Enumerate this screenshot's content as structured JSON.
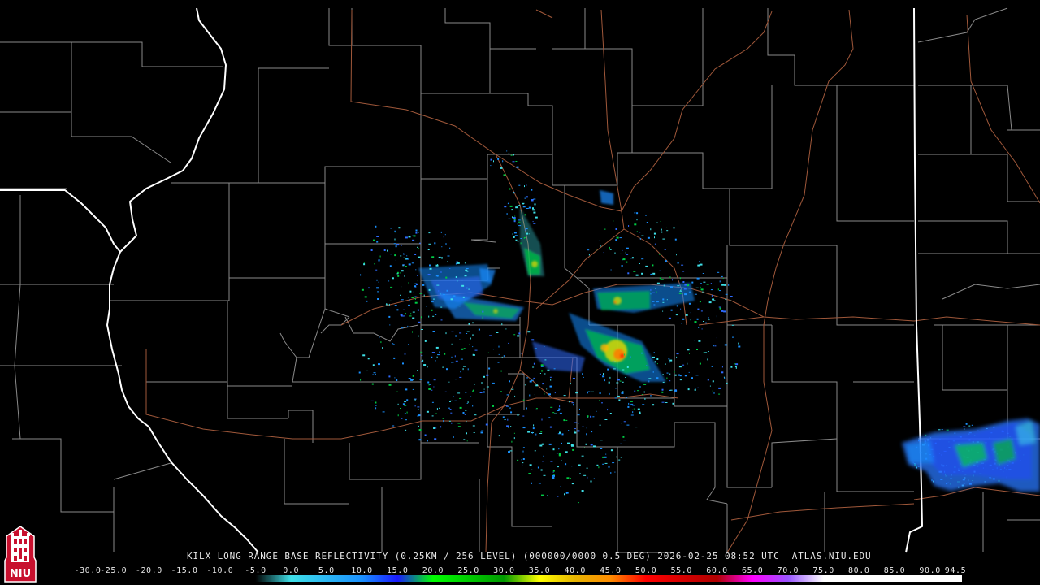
{
  "caption": "KILX LONG RANGE BASE REFLECTIVITY (0.25KM / 256 LEVEL) (000000/0000 0.5 DEG) 2026-02-25 08:52 UTC  ATLAS.NIU.EDU",
  "logo": {
    "text": "NIU",
    "color": "#c8102e"
  },
  "colors": {
    "background": "#000000",
    "county_lines": "#8a8a8a",
    "state_lines": "#ffffff",
    "highways": "#a0583a"
  },
  "scale": {
    "labels": [
      "-30.0",
      "-25.0",
      "-20.0",
      "-15.0",
      "-10.0",
      "-5.0",
      "0.0",
      "5.0",
      "10.0",
      "15.0",
      "20.0",
      "25.0",
      "30.0",
      "35.0",
      "40.0",
      "45.0",
      "50.0",
      "55.0",
      "60.0",
      "65.0",
      "70.0",
      "75.0",
      "80.0",
      "85.0",
      "90.0",
      "94.5"
    ],
    "stops": [
      {
        "dbz": -30,
        "color": "#000000"
      },
      {
        "dbz": -5,
        "color": "#000000"
      },
      {
        "dbz": 0,
        "color": "#3fe0e8"
      },
      {
        "dbz": 10,
        "color": "#1a90ff"
      },
      {
        "dbz": 15,
        "color": "#1a1aff"
      },
      {
        "dbz": 20,
        "color": "#00ff00"
      },
      {
        "dbz": 30,
        "color": "#009900"
      },
      {
        "dbz": 35,
        "color": "#ffff00"
      },
      {
        "dbz": 40,
        "color": "#e6b400"
      },
      {
        "dbz": 45,
        "color": "#ff8c00"
      },
      {
        "dbz": 50,
        "color": "#ff0000"
      },
      {
        "dbz": 60,
        "color": "#b00000"
      },
      {
        "dbz": 65,
        "color": "#ff00ff"
      },
      {
        "dbz": 70,
        "color": "#9955ff"
      },
      {
        "dbz": 75,
        "color": "#ffffff"
      },
      {
        "dbz": 94.5,
        "color": "#ffffff"
      }
    ]
  }
}
